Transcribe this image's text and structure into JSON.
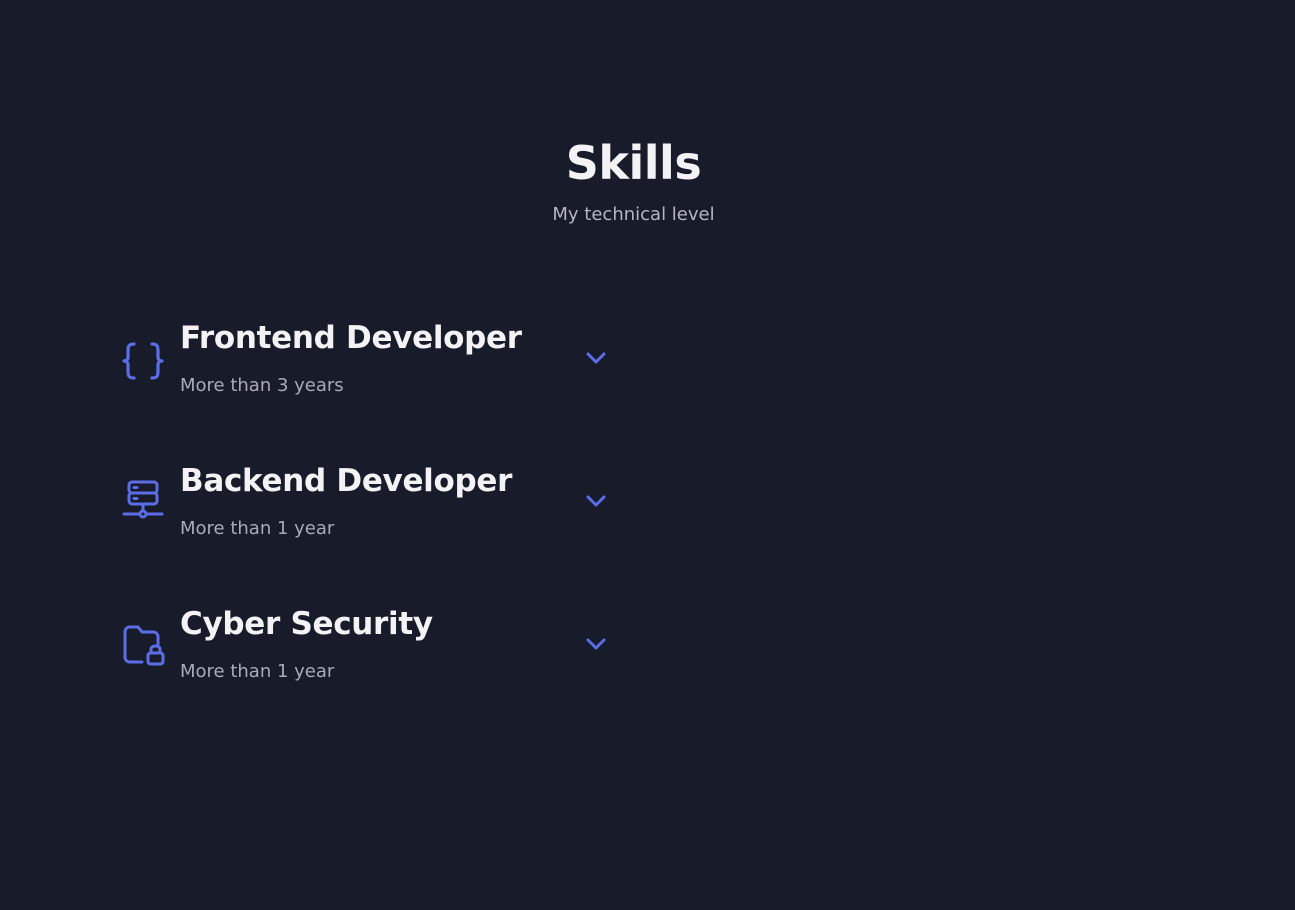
{
  "section": {
    "title": "Skills",
    "subtitle": "My technical level"
  },
  "colors": {
    "background": "#181b29",
    "accent": "#5b6ee8",
    "title": "#f3f3f6",
    "subtitle": "#a9abbb"
  },
  "skills": [
    {
      "title": "Frontend Developer",
      "subtitle": "More than 3 years",
      "icon": "braces-icon"
    },
    {
      "title": "Backend Developer",
      "subtitle": "More than 1 year",
      "icon": "server-icon"
    },
    {
      "title": "Cyber Security",
      "subtitle": "More than 1 year",
      "icon": "folder-lock-icon"
    }
  ]
}
